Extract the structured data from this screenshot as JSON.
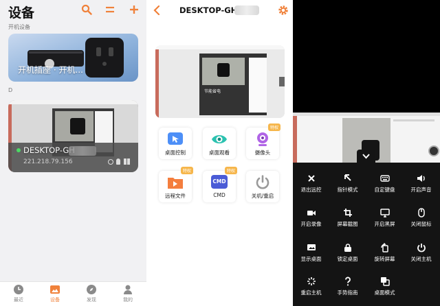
{
  "devices_screen": {
    "title": "设备",
    "section_powered": "开机设备",
    "section_d": "D",
    "plug_card": {
      "name": "开机插座 · 开机..."
    },
    "pc_card": {
      "name": "DESKTOP-GH",
      "ip": "221.218.79.156",
      "status_color": "#4cd964"
    },
    "tabs": [
      {
        "label": "最近",
        "icon": "clock-icon"
      },
      {
        "label": "设备",
        "icon": "image-icon",
        "active": true
      },
      {
        "label": "发现",
        "icon": "compass-icon"
      },
      {
        "label": "我的",
        "icon": "person-icon"
      }
    ],
    "accent_color": "#f0813a"
  },
  "detail_screen": {
    "title": "DESKTOP-GH",
    "preview_caption": "节能省电",
    "functions": [
      {
        "label": "桌面控制",
        "icon": "remote-desktop-icon",
        "badge": ""
      },
      {
        "label": "桌面观看",
        "icon": "eye-icon",
        "badge": ""
      },
      {
        "label": "摄像头",
        "icon": "camera-icon",
        "badge": "特权"
      },
      {
        "label": "远程文件",
        "icon": "file-transfer-icon",
        "badge": "特权"
      },
      {
        "label": "CMD",
        "icon": "cmd-icon",
        "badge": "特权",
        "icon_text": "CMD"
      },
      {
        "label": "关机/重启",
        "icon": "power-icon",
        "badge": ""
      }
    ]
  },
  "remote_screen": {
    "menu": [
      {
        "label": "退出远控",
        "icon": "close-icon"
      },
      {
        "label": "指针模式",
        "icon": "pointer-icon"
      },
      {
        "label": "自定键盘",
        "icon": "keyboard-icon"
      },
      {
        "label": "开启声音",
        "icon": "speaker-icon"
      },
      {
        "label": "开启录像",
        "icon": "video-icon"
      },
      {
        "label": "屏幕截图",
        "icon": "crop-icon"
      },
      {
        "label": "开启黑屏",
        "icon": "monitor-icon"
      },
      {
        "label": "关闭鼠标",
        "icon": "mouse-icon"
      },
      {
        "label": "显示桌面",
        "icon": "desktop-icon"
      },
      {
        "label": "锁定桌面",
        "icon": "lock-icon"
      },
      {
        "label": "旋转屏幕",
        "icon": "rotate-icon"
      },
      {
        "label": "关闭主机",
        "icon": "power-icon"
      },
      {
        "label": "重启主机",
        "icon": "restart-icon"
      },
      {
        "label": "手势指南",
        "icon": "question-icon"
      },
      {
        "label": "桌面模式",
        "icon": "copy-window-icon"
      }
    ]
  }
}
